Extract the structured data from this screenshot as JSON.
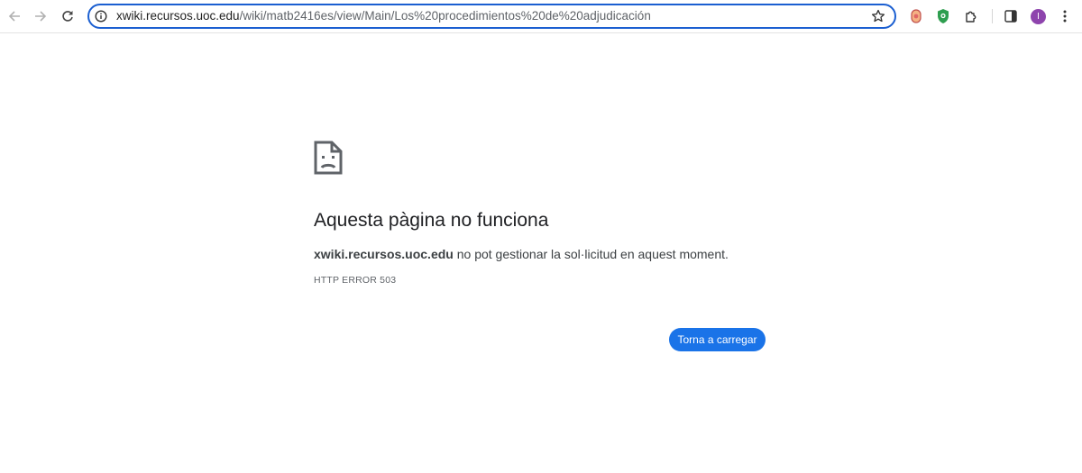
{
  "browser": {
    "url_host": "xwiki.recursos.uoc.edu",
    "url_path": "/wiki/matb2416es/view/Main/Los%20procedimientos%20de%20adjudicación",
    "profile_initial": "I",
    "icons": [
      "back-icon",
      "forward-icon",
      "reload-icon",
      "site-info-icon",
      "star-icon",
      "extension-orange-icon",
      "extension-shield-icon",
      "extensions-puzzle-icon",
      "side-panel-icon",
      "profile-avatar",
      "more-menu-icon"
    ],
    "colors": {
      "focus_ring": "#1b5fd1",
      "avatar": "#8e44ad"
    }
  },
  "error": {
    "icon": "sad-document-icon",
    "title": "Aquesta pàgina no funciona",
    "host": "xwiki.recursos.uoc.edu",
    "message": " no pot gestionar la sol·licitud en aquest moment.",
    "code": "HTTP ERROR 503",
    "reload_label": "Torna a carregar",
    "colors": {
      "button": "#1a73e8"
    }
  }
}
